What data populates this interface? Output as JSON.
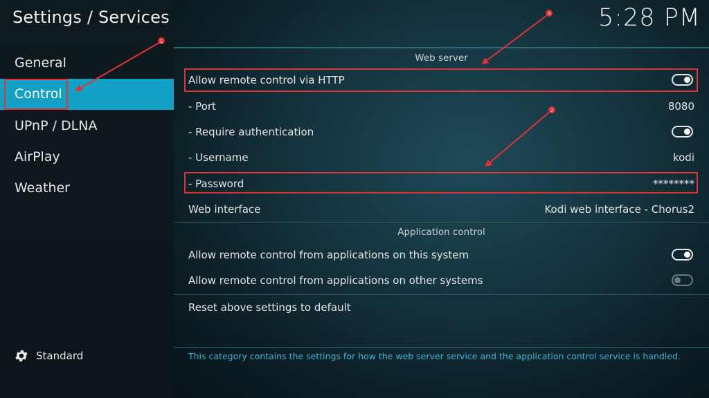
{
  "header": {
    "title": "Settings / Services",
    "clock": "5:28 PM"
  },
  "sidebar": {
    "items": [
      {
        "label": "General"
      },
      {
        "label": "Control"
      },
      {
        "label": "UPnP / DLNA"
      },
      {
        "label": "AirPlay"
      },
      {
        "label": "Weather"
      }
    ],
    "active": "Control",
    "settings_level": "Standard"
  },
  "web_server": {
    "section_title": "Web server",
    "allow_http": {
      "label": "Allow remote control via HTTP",
      "enabled": true
    },
    "port": {
      "label": "- Port",
      "value": "8080"
    },
    "require_auth": {
      "label": "- Require authentication",
      "enabled": true
    },
    "username": {
      "label": "- Username",
      "value": "kodi"
    },
    "password": {
      "label": "- Password",
      "value": "********"
    },
    "web_interface": {
      "label": "Web interface",
      "value": "Kodi web interface - Chorus2"
    }
  },
  "application_control": {
    "section_title": "Application control",
    "this_system": {
      "label": "Allow remote control from applications on this system",
      "enabled": true
    },
    "other_systems": {
      "label": "Allow remote control from applications on other systems",
      "enabled": false
    }
  },
  "reset": {
    "label": "Reset above settings to default"
  },
  "description": "This category contains the settings for how the web server service and the application control service is handled.",
  "annotations": {
    "badge_1": "1",
    "badge_2": "2",
    "badge_3": "3"
  },
  "colors": {
    "accent": "#12a0c4",
    "annotation": "#e03434",
    "description_text": "#3cb3d6"
  }
}
